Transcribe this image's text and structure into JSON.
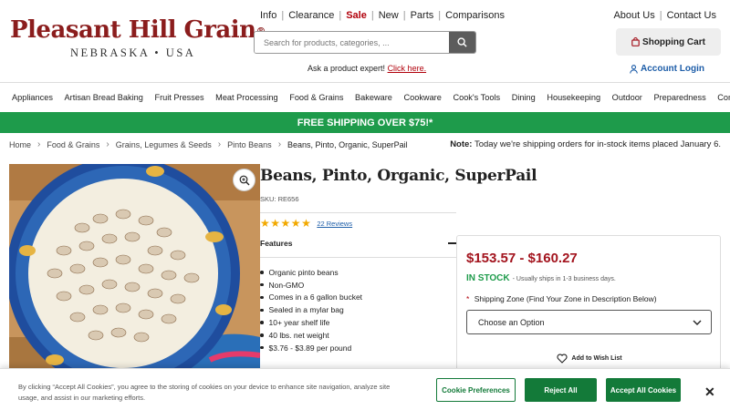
{
  "brand": {
    "name": "Pleasant Hill Grain",
    "reg": "®",
    "tagline": "NEBRASKA • USA"
  },
  "topnav": {
    "items": [
      "Info",
      "Clearance",
      "Sale",
      "New",
      "Parts",
      "Comparisons"
    ],
    "separator": "|"
  },
  "toplinks": {
    "about": "About Us",
    "contact": "Contact Us"
  },
  "search": {
    "placeholder": "Search for products, categories, ..."
  },
  "expert": {
    "text": "Ask a product expert!",
    "link": "Click here."
  },
  "cart": {
    "label": "Shopping Cart"
  },
  "account": {
    "label": "Account Login"
  },
  "categories": [
    "Appliances",
    "Artisan Bread Baking",
    "Fruit Presses",
    "Meat Processing",
    "Food & Grains",
    "Bakeware",
    "Cookware",
    "Cook's Tools",
    "Dining",
    "Housekeeping",
    "Outdoor",
    "Preparedness",
    "Commercial"
  ],
  "promo": {
    "text": "FREE SHIPPING OVER $75!*"
  },
  "breadcrumb": [
    "Home",
    "Food & Grains",
    "Grains, Legumes & Seeds",
    "Pinto Beans",
    "Beans, Pinto, Organic, SuperPail"
  ],
  "note": {
    "label": "Note:",
    "text": "Today we're shipping orders for in-stock items placed January 6."
  },
  "product": {
    "title": "Beans, Pinto, Organic, SuperPail",
    "sku": "SKU: RE656",
    "rating": 5,
    "reviews": "22 Reviews",
    "features_title": "Features",
    "features": [
      "Organic pinto beans",
      "Non-GMO",
      "Comes in a 6 gallon bucket",
      "Sealed in a mylar bag",
      "10+ year shelf life",
      "40 lbs. net weight",
      "$3.76 - $3.89 per pound"
    ],
    "price": "$153.57 - $160.27",
    "stock": "IN STOCK",
    "stock_note": "- Usually ships in 1-3 business days.",
    "shipping_label": "Shipping Zone (Find Your Zone in Description Below)",
    "required_mark": "*",
    "select_value": "Choose an Option",
    "wishlist": "Add to Wish List"
  },
  "cookie": {
    "text": "By clicking “Accept All Cookies”, you agree to the storing of cookies on your device to enhance site navigation, analyze site usage, and assist in our marketing efforts.",
    "preferences": "Cookie Preferences",
    "reject": "Reject All",
    "accept": "Accept All Cookies",
    "close": "✕"
  },
  "colors": {
    "brand_red": "#8b1d1d",
    "sale_red": "#b1000b",
    "promo_green": "#1e9b4b",
    "link_blue": "#1d5da8",
    "star": "#f2a900"
  }
}
